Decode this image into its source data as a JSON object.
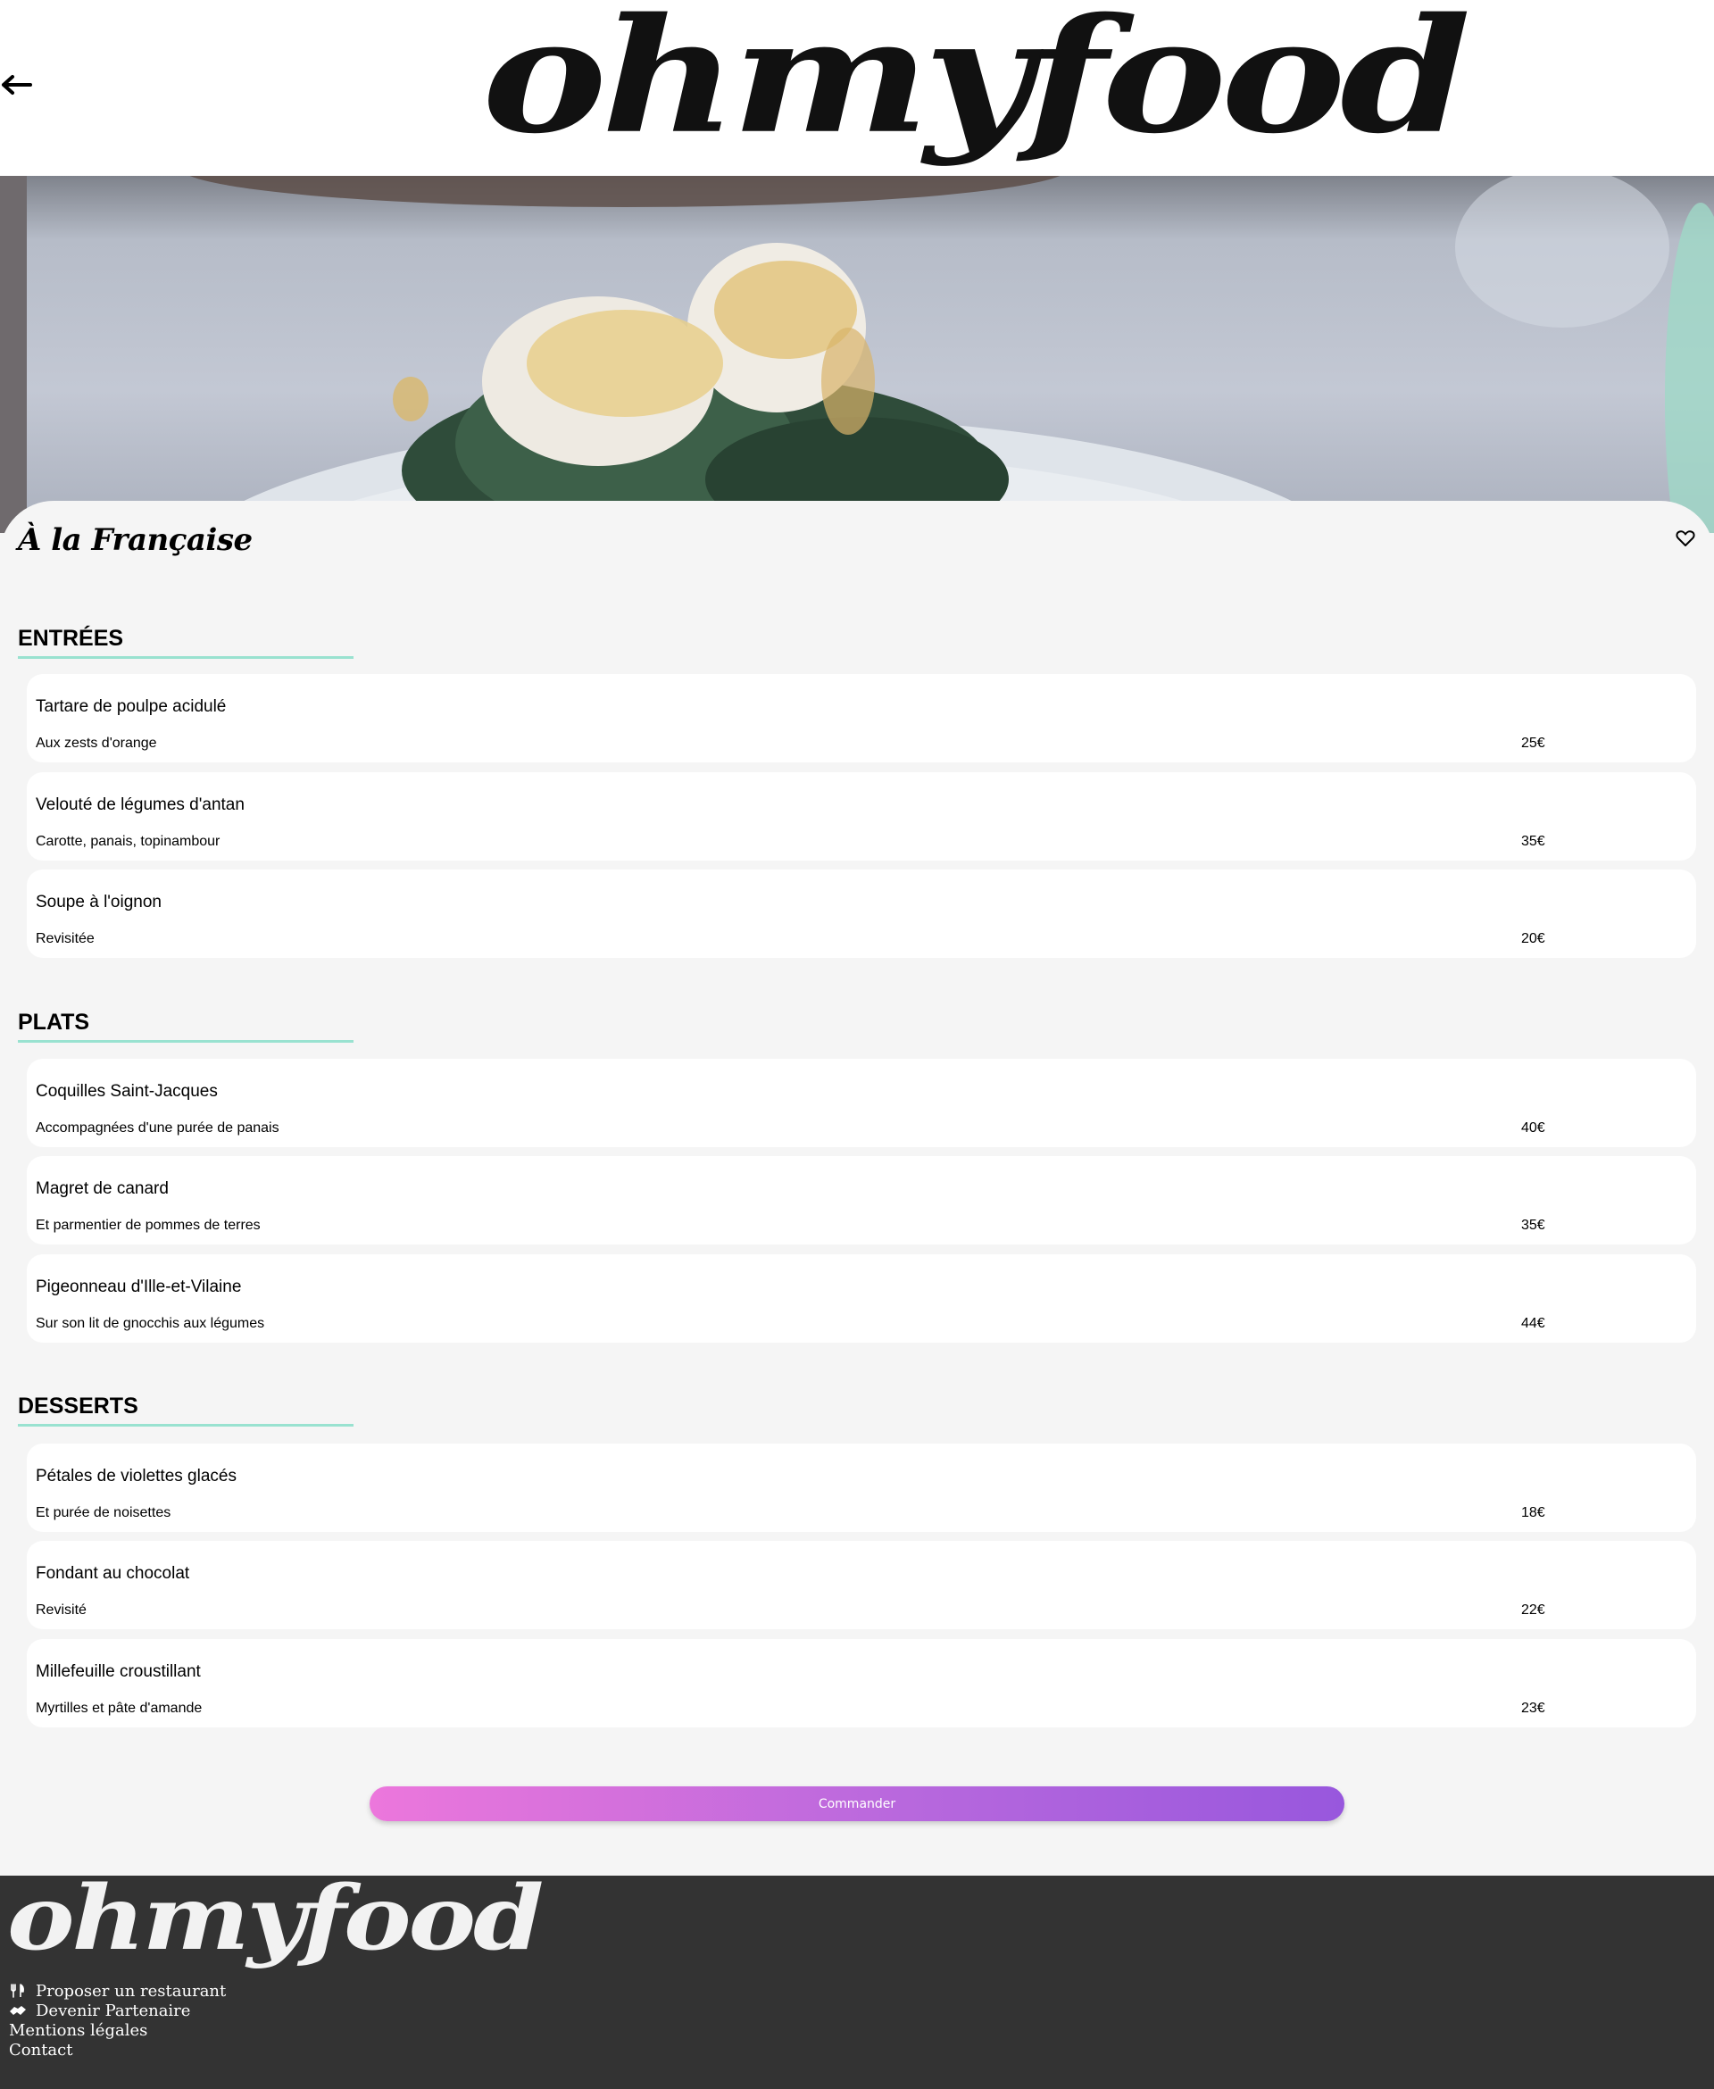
{
  "header": {
    "back_icon": "arrow-left-icon",
    "logo": "ohmyfood"
  },
  "restaurant": {
    "name": "À la Française",
    "like_icon": "heart-outline-icon"
  },
  "menu": {
    "sections": [
      {
        "title": "ENTRÉES",
        "dishes": [
          {
            "name": "Tartare de poulpe acidulé",
            "description": "Aux zests d'orange",
            "price": "25€"
          },
          {
            "name": "Velouté de légumes d'antan",
            "description": "Carotte, panais, topinambour",
            "price": "35€"
          },
          {
            "name": "Soupe à l'oignon",
            "description": "Revisitée",
            "price": "20€"
          }
        ]
      },
      {
        "title": "PLATS",
        "dishes": [
          {
            "name": "Coquilles Saint-Jacques",
            "description": "Accompagnées d'une purée de panais",
            "price": "40€"
          },
          {
            "name": "Magret de canard",
            "description": "Et parmentier de pommes de terres",
            "price": "35€"
          },
          {
            "name": "Pigeonneau d'Ille-et-Vilaine",
            "description": "Sur son lit de gnocchis aux légumes",
            "price": "44€"
          }
        ]
      },
      {
        "title": "DESSERTS",
        "dishes": [
          {
            "name": "Pétales de violettes glacés",
            "description": "Et purée de noisettes",
            "price": "18€"
          },
          {
            "name": "Fondant au chocolat",
            "description": "Revisité",
            "price": "22€"
          },
          {
            "name": "Millefeuille croustillant",
            "description": "Myrtilles et pâte d'amande",
            "price": "23€"
          }
        ]
      }
    ],
    "order_button": "Commander"
  },
  "footer": {
    "logo": "ohmyfood",
    "links": [
      {
        "label": "Proposer un restaurant",
        "icon": "utensils-icon"
      },
      {
        "label": "Devenir Partenaire",
        "icon": "handshake-icon"
      },
      {
        "label": "Mentions légales"
      },
      {
        "label": "Contact"
      }
    ]
  },
  "colors": {
    "accent_line": "#99e2d0",
    "button_gradient_start": "#ec77dc",
    "button_gradient_end": "#9857dd",
    "footer_bg": "#333333",
    "page_bg": "#f5f5f5"
  }
}
